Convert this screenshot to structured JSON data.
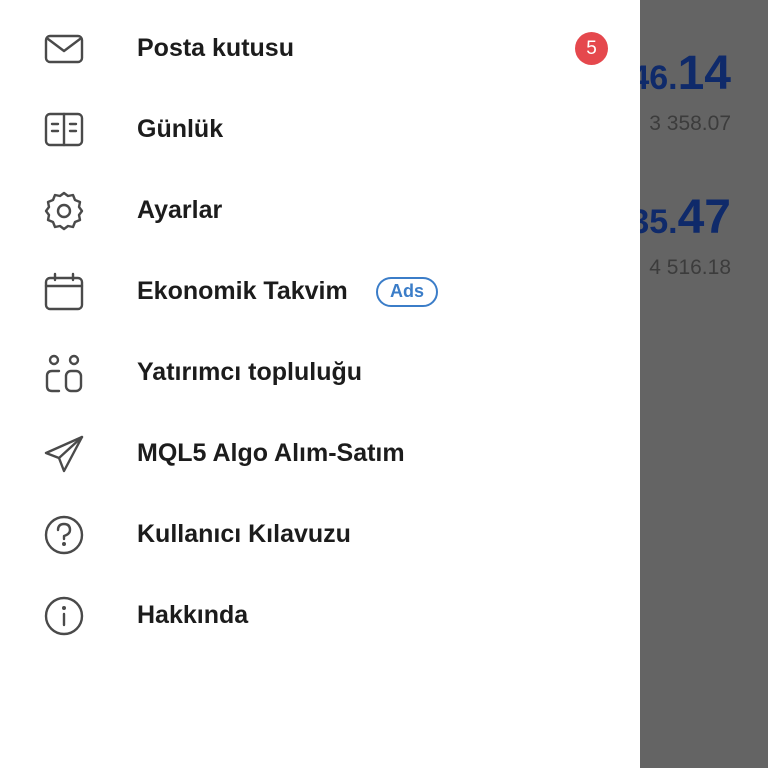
{
  "background": {
    "quotes": [
      {
        "price_small": "46.",
        "price_big": "14",
        "sub": "3 358.07"
      },
      {
        "price_small": "35.",
        "price_big": "47",
        "sub": "4 516.18"
      }
    ]
  },
  "drawer": {
    "items": [
      {
        "label": "Posta kutusu",
        "icon": "mail-icon",
        "badge": "5"
      },
      {
        "label": "Günlük",
        "icon": "journal-icon"
      },
      {
        "label": "Ayarlar",
        "icon": "gear-icon"
      },
      {
        "label": "Ekonomik Takvim",
        "icon": "calendar-icon",
        "tag": "Ads"
      },
      {
        "label": "Yatırımcı topluluğu",
        "icon": "community-icon"
      },
      {
        "label": "MQL5 Algo Alım-Satım",
        "icon": "send-icon"
      },
      {
        "label": "Kullanıcı Kılavuzu",
        "icon": "help-icon"
      },
      {
        "label": "Hakkında",
        "icon": "info-icon"
      }
    ]
  },
  "colors": {
    "badge": "#e5484d",
    "ads": "#3b7dc8",
    "price": "#0f2a6a",
    "scrim": "#646464"
  }
}
